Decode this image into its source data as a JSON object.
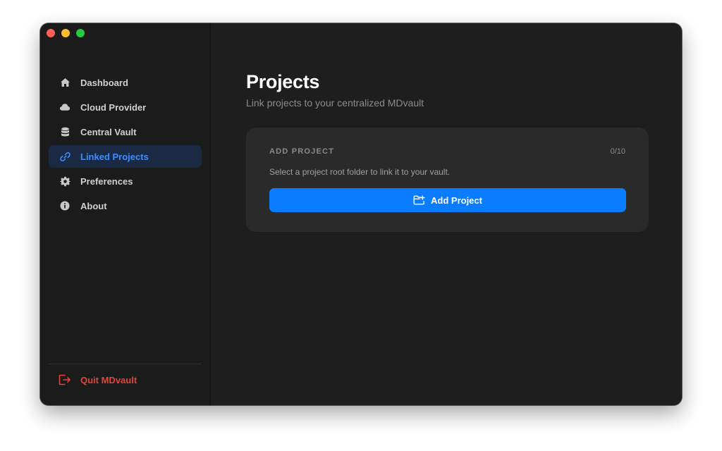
{
  "window": {
    "traffic_lights": [
      "close",
      "minimize",
      "zoom"
    ]
  },
  "sidebar": {
    "items": [
      {
        "label": "Dashboard",
        "icon": "home-icon",
        "active": false
      },
      {
        "label": "Cloud Provider",
        "icon": "cloud-icon",
        "active": false
      },
      {
        "label": "Central Vault",
        "icon": "database-icon",
        "active": false
      },
      {
        "label": "Linked Projects",
        "icon": "link-icon",
        "active": true
      },
      {
        "label": "Preferences",
        "icon": "gear-icon",
        "active": false
      },
      {
        "label": "About",
        "icon": "info-icon",
        "active": false
      }
    ],
    "quit_label": "Quit MDvault",
    "quit_icon": "sign-out-icon"
  },
  "main": {
    "title": "Projects",
    "subtitle": "Link projects to your centralized MDvault",
    "card": {
      "title": "ADD PROJECT",
      "count": "0/10",
      "description": "Select a project root folder to link it to your vault.",
      "button_label": "Add Project",
      "button_icon": "folder-plus-icon"
    }
  },
  "colors": {
    "accent": "#0a7cff",
    "active_item_bg": "#1a2a45",
    "active_item_text": "#3f8cff",
    "danger": "#e0463c",
    "sidebar_bg": "#1b1b1b",
    "main_bg": "#1e1e1e",
    "card_bg": "#2a2a2a"
  }
}
